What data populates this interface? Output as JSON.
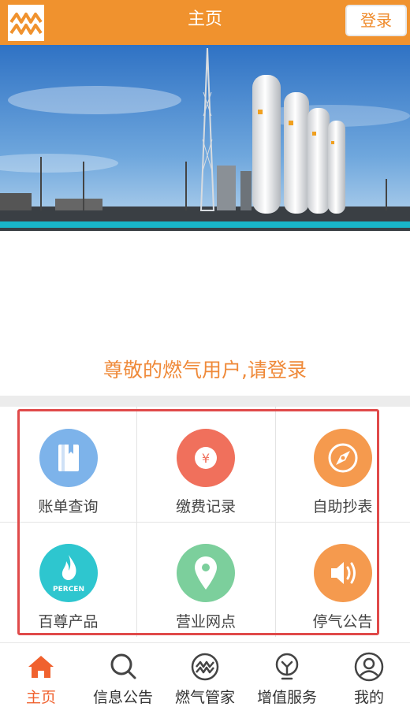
{
  "header": {
    "title": "主页",
    "login_label": "登录"
  },
  "greeting": "尊敬的燃气用户,请登录",
  "grid": {
    "items": [
      {
        "label": "账单查询",
        "icon": "book-icon",
        "color": "#7db3ea"
      },
      {
        "label": "缴费记录",
        "icon": "yen-icon",
        "color": "#f0705c"
      },
      {
        "label": "自助抄表",
        "icon": "compass-icon",
        "color": "#f59a4e"
      },
      {
        "label": "百尊产品",
        "icon": "flame-icon",
        "color": "#2ec6cf",
        "icon_text": "PERCEN"
      },
      {
        "label": "营业网点",
        "icon": "location-pin-icon",
        "color": "#7ccf9c"
      },
      {
        "label": "停气公告",
        "icon": "speaker-icon",
        "color": "#f59a4e"
      }
    ]
  },
  "nav": {
    "items": [
      {
        "label": "主页",
        "icon": "home-icon",
        "active": true
      },
      {
        "label": "信息公告",
        "icon": "search-icon",
        "active": false
      },
      {
        "label": "燃气管家",
        "icon": "flame-logo-icon",
        "active": false
      },
      {
        "label": "增值服务",
        "icon": "bulb-icon",
        "active": false
      },
      {
        "label": "我的",
        "icon": "user-icon",
        "active": false
      }
    ]
  },
  "colors": {
    "accent": "#f0922e",
    "active_nav": "#f0612e",
    "highlight_border": "#e04a4a"
  }
}
